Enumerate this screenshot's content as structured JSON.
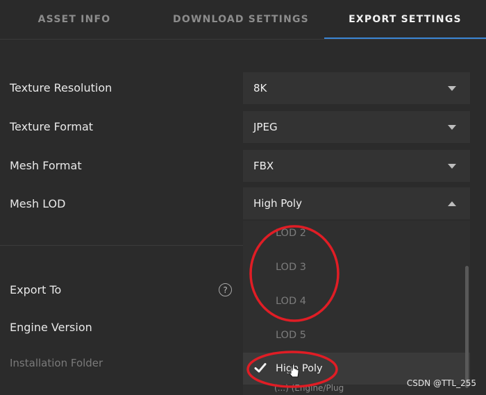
{
  "tabs": [
    {
      "label": "ASSET INFO",
      "active": false
    },
    {
      "label": "DOWNLOAD SETTINGS",
      "active": false
    },
    {
      "label": "EXPORT SETTINGS",
      "active": true
    }
  ],
  "settings": {
    "texture_resolution": {
      "label": "Texture Resolution",
      "value": "8K"
    },
    "texture_format": {
      "label": "Texture Format",
      "value": "JPEG"
    },
    "mesh_format": {
      "label": "Mesh Format",
      "value": "FBX"
    },
    "mesh_lod": {
      "label": "Mesh LOD",
      "value": "High Poly"
    }
  },
  "export": {
    "export_to_label": "Export To",
    "help_glyph": "?",
    "engine_version_label": "Engine Version",
    "installation_folder_label": "Installation Folder"
  },
  "lod_dropdown": {
    "options": [
      "LOD 2",
      "LOD 3",
      "LOD 4",
      "LOD 5",
      "High Poly"
    ],
    "selected": "High Poly"
  },
  "partial_text": "(...) (Engine/Plug",
  "watermark": "CSDN @TTL_255",
  "colors": {
    "accent": "#3a86d6",
    "annotation": "#e01d25"
  }
}
